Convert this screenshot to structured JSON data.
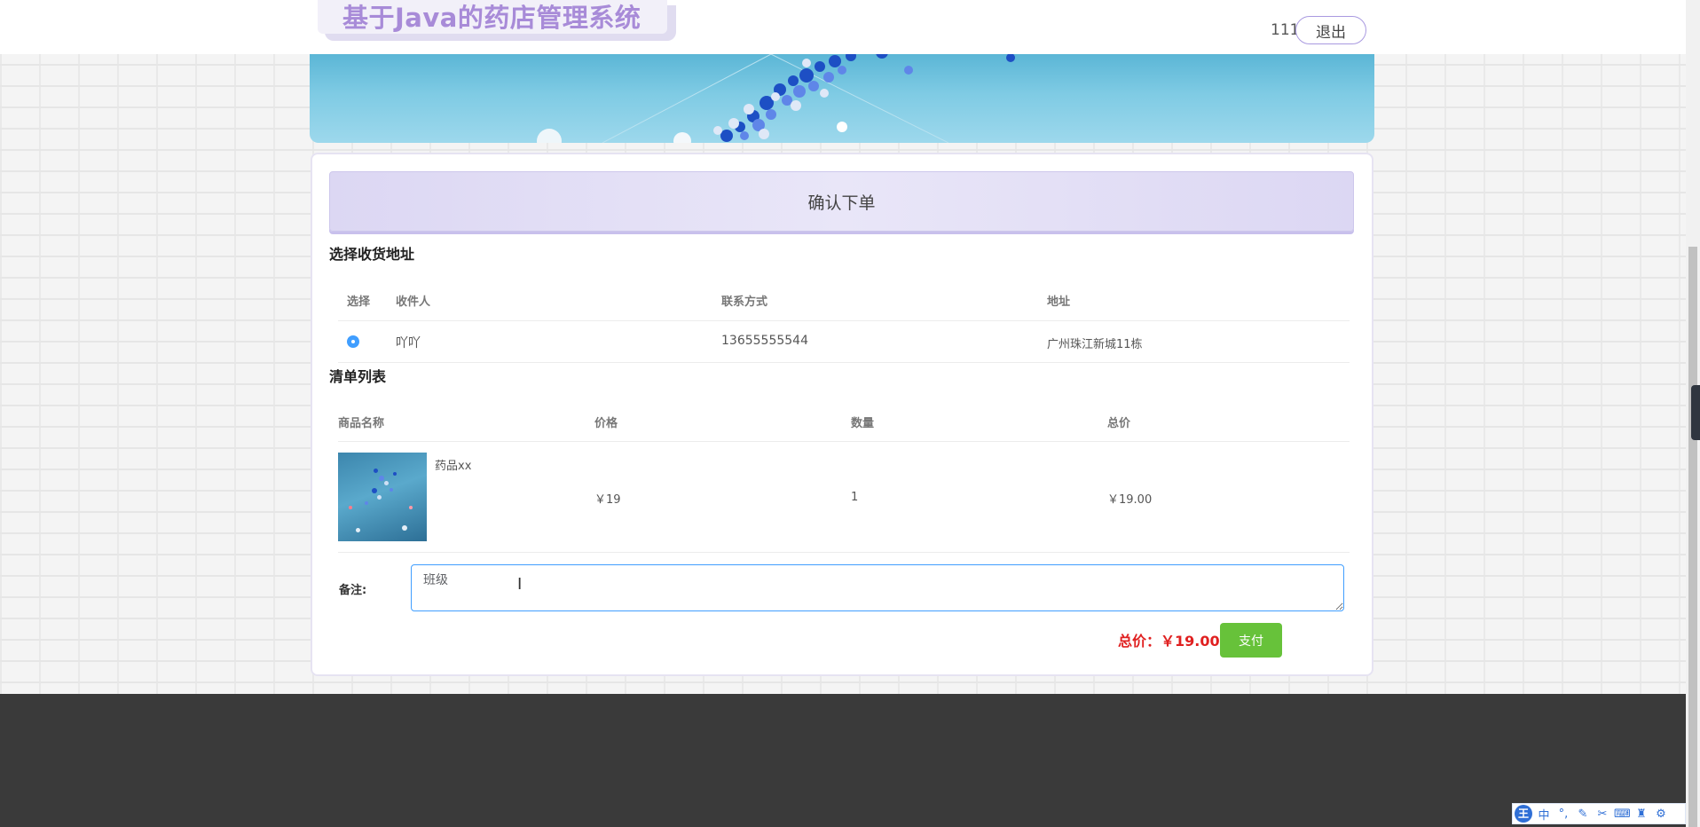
{
  "header": {
    "site_title": "基于Java的药店管理系统",
    "username": "111",
    "logout_label": "退出"
  },
  "page": {
    "title": "确认下单"
  },
  "address_section": {
    "title": "选择收货地址",
    "columns": [
      "选择",
      "收件人",
      "联系方式",
      "地址"
    ],
    "rows": [
      {
        "selected": true,
        "recipient": "吖吖",
        "phone": "13655555544",
        "address": "广州珠江新城11栋"
      }
    ]
  },
  "order_section": {
    "title": "清单列表",
    "columns": [
      "商品名称",
      "价格",
      "数量",
      "总价"
    ],
    "items": [
      {
        "name": "药品xx",
        "price": "￥19",
        "quantity": "1",
        "subtotal": "￥19.00"
      }
    ]
  },
  "remark": {
    "label": "备注:",
    "value": "班级"
  },
  "summary": {
    "total_label": "总价：￥19.00",
    "pay_label": "支付"
  },
  "ime_toolbar": {
    "logo": "王",
    "mode": "中",
    "icons": [
      "punctuation-icon",
      "pen-icon",
      "scissors-icon",
      "keyboard-icon",
      "skin-icon",
      "settings-icon"
    ]
  },
  "colors": {
    "accent": "#409eff",
    "pay": "#67c23a",
    "total": "#e02020",
    "title_purple": "#a88bd8",
    "footer": "#3a3a3a"
  }
}
